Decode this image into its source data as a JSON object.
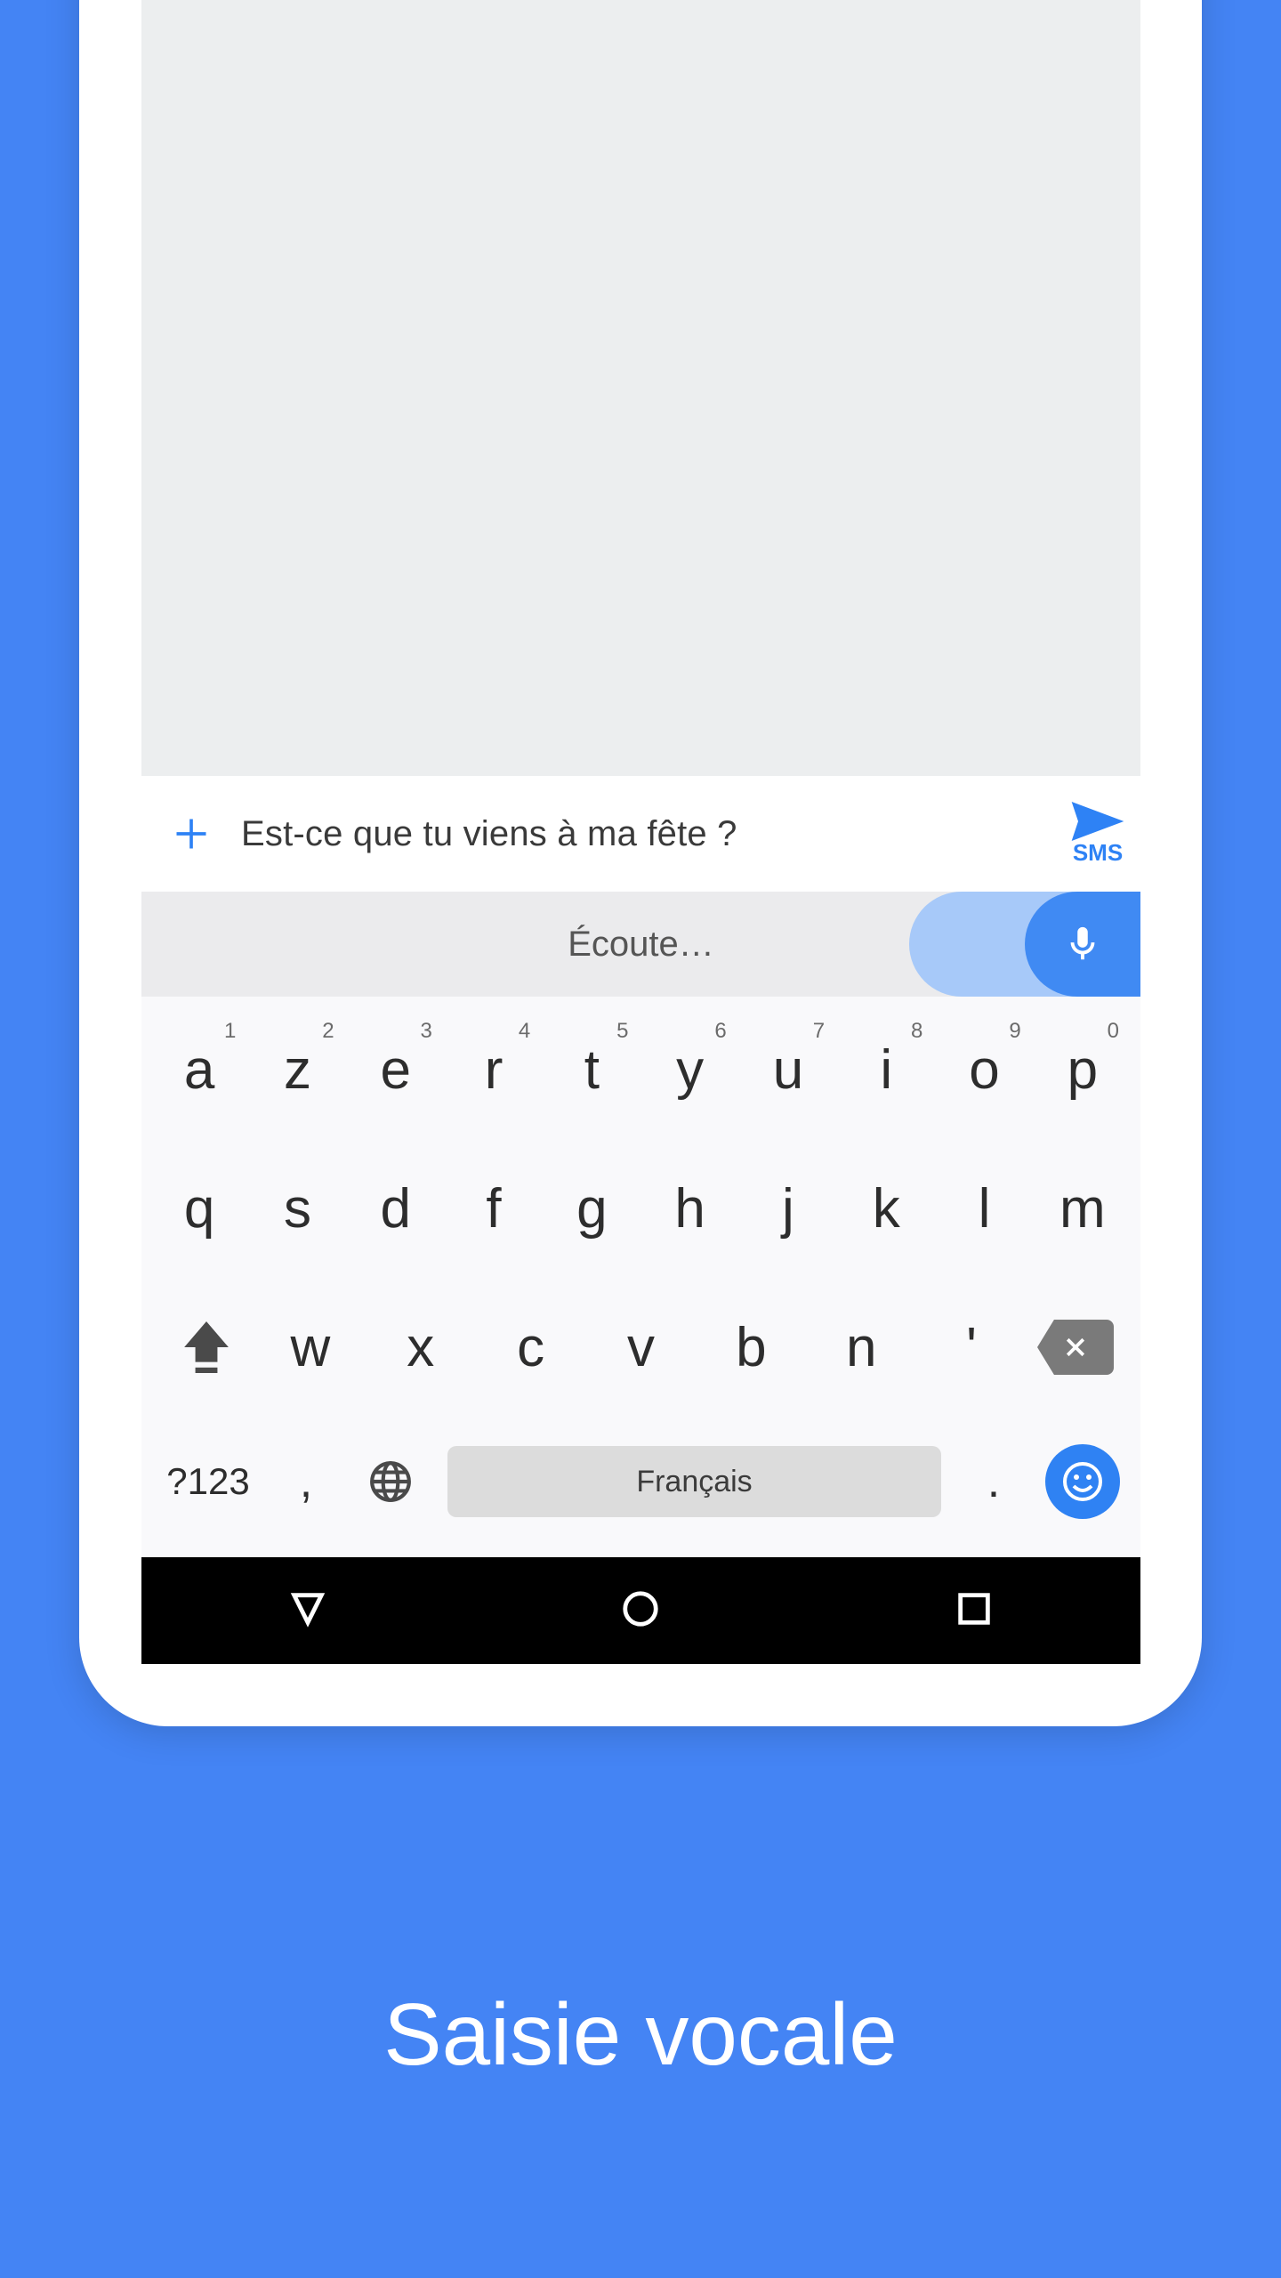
{
  "input": {
    "text": "Est-ce que tu viens à ma fête ?",
    "send_label": "SMS"
  },
  "voice": {
    "label": "Écoute…"
  },
  "keyboard": {
    "row1": [
      {
        "char": "a",
        "sup": "1"
      },
      {
        "char": "z",
        "sup": "2"
      },
      {
        "char": "e",
        "sup": "3"
      },
      {
        "char": "r",
        "sup": "4"
      },
      {
        "char": "t",
        "sup": "5"
      },
      {
        "char": "y",
        "sup": "6"
      },
      {
        "char": "u",
        "sup": "7"
      },
      {
        "char": "i",
        "sup": "8"
      },
      {
        "char": "o",
        "sup": "9"
      },
      {
        "char": "p",
        "sup": "0"
      }
    ],
    "row2": [
      "q",
      "s",
      "d",
      "f",
      "g",
      "h",
      "j",
      "k",
      "l",
      "m"
    ],
    "row3": [
      "w",
      "x",
      "c",
      "v",
      "b",
      "n",
      "'"
    ],
    "symbols_label": "?123",
    "comma": ",",
    "period": ".",
    "space_label": "Français"
  },
  "caption": "Saisie vocale"
}
